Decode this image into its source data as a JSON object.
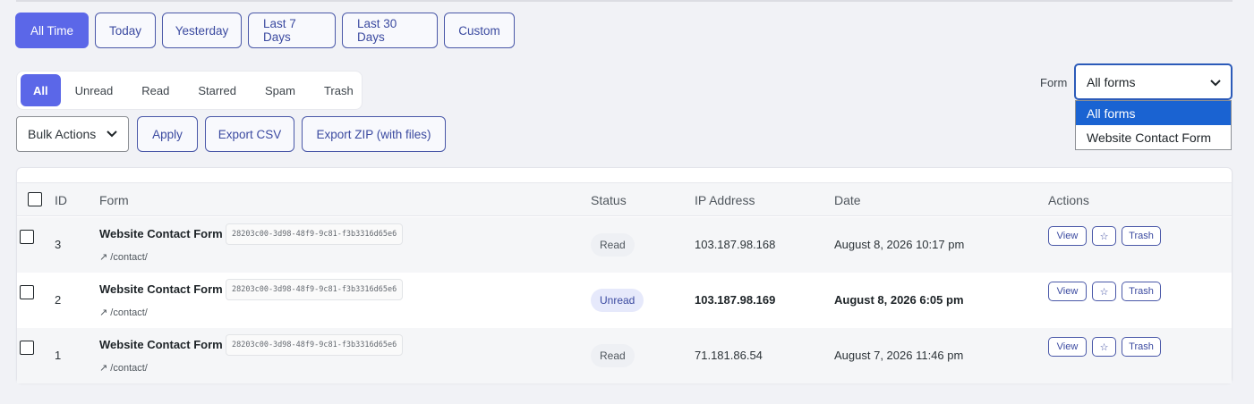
{
  "date_range": {
    "buttons": [
      "All Time",
      "Today",
      "Yesterday",
      "Last 7 Days",
      "Last 30 Days",
      "Custom"
    ],
    "active": "All Time"
  },
  "status_tabs": {
    "tabs": [
      "All",
      "Unread",
      "Read",
      "Starred",
      "Spam",
      "Trash"
    ],
    "active": "All"
  },
  "bulk": {
    "select_value": "Bulk Actions",
    "apply_label": "Apply",
    "export_csv_label": "Export CSV",
    "export_zip_label": "Export ZIP (with files)"
  },
  "form_filter": {
    "label": "Form",
    "selected": "All forms",
    "options": [
      "All forms",
      "Website Contact Form"
    ]
  },
  "table": {
    "headers": {
      "id": "ID",
      "form": "Form",
      "status": "Status",
      "ip": "IP Address",
      "date": "Date",
      "actions": "Actions"
    },
    "rows": [
      {
        "id": "3",
        "form": "Website Contact Form",
        "uuid": "28203c00-3d98-48f9-9c81-f3b3316d65e6",
        "path": "↗ /contact/",
        "status": "Read",
        "ip": "103.187.98.168",
        "date": "August 8, 2026 10:17 pm",
        "unread": false
      },
      {
        "id": "2",
        "form": "Website Contact Form",
        "uuid": "28203c00-3d98-48f9-9c81-f3b3316d65e6",
        "path": "↗ /contact/",
        "status": "Unread",
        "ip": "103.187.98.169",
        "date": "August 8, 2026 6:05 pm",
        "unread": true
      },
      {
        "id": "1",
        "form": "Website Contact Form",
        "uuid": "28203c00-3d98-48f9-9c81-f3b3316d65e6",
        "path": "↗ /contact/",
        "status": "Read",
        "ip": "71.181.86.54",
        "date": "August 7, 2026 11:46 pm",
        "unread": false
      }
    ],
    "row_actions": {
      "view": "View",
      "star": "☆",
      "trash": "Trash"
    }
  },
  "colors": {
    "accent": "#5b67e8",
    "outline": "#4a58a8",
    "dropdown_selected": "#1a63d2"
  }
}
